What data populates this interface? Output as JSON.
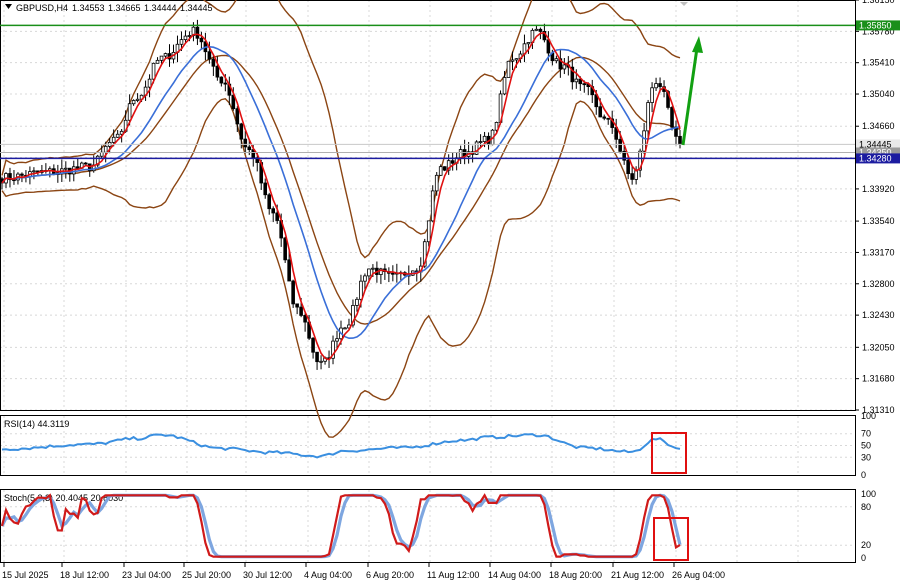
{
  "colors": {
    "background": "#ffffff",
    "grid": "#d8d8d8",
    "candle": "#000000",
    "bollinger": "#8b4513",
    "ma_fast": "#e01010",
    "ma_slow": "#3a6fd8",
    "resistance": "#1a8f1a",
    "support": "#1c1ca0",
    "arrow": "#12a012",
    "rsi": "#3a8fe0",
    "stoch_main": "#d01a1a",
    "stoch_signal": "#7ea6e0",
    "highlight_box": "#e01010"
  },
  "header": {
    "symbol": "GBPUSD,H4",
    "open": "1.34553",
    "high": "1.34665",
    "low": "1.34444",
    "close": "1.34445"
  },
  "price_scale": {
    "ticks": [
      "1.36150",
      "1.35780",
      "1.35410",
      "1.35040",
      "1.34660",
      "1.34290",
      "1.33920",
      "1.33540",
      "1.33170",
      "1.32800",
      "1.32430",
      "1.32050",
      "1.31680",
      "1.31310"
    ],
    "tags": [
      {
        "text": "1.35850",
        "bg": "#1a8f1a",
        "fg": "#ffffff",
        "price": 1.3585
      },
      {
        "text": "1.34445",
        "bg": "#e8e8e8",
        "fg": "#000000",
        "price": 1.34445
      },
      {
        "text": "1.34350",
        "bg": "#9a9a9a",
        "fg": "#ffffff",
        "price": 1.3435
      },
      {
        "text": "1.34280",
        "bg": "#1c1ca0",
        "fg": "#ffffff",
        "price": 1.3428
      }
    ]
  },
  "levels": {
    "resistance": 1.3585,
    "support": 1.3428,
    "current": 1.34445,
    "mid": 1.3435
  },
  "rsi_panel": {
    "label": "RSI(14) 44.3119",
    "ticks": [
      "100",
      "70",
      "50",
      "30",
      "0"
    ]
  },
  "stoch_panel": {
    "label": "Stoch(5,3,3) 20.4045 20.8030",
    "ticks": [
      "100",
      "80",
      "20",
      "0"
    ]
  },
  "time_axis": [
    "15 Jul 2025",
    "18 Jul 12:00",
    "23 Jul 04:00",
    "25 Jul 20:00",
    "30 Jul 12:00",
    "4 Aug 04:00",
    "6 Aug 20:00",
    "11 Aug 12:00",
    "14 Aug 04:00",
    "18 Aug 20:00",
    "21 Aug 12:00",
    "26 Aug 04:00"
  ],
  "chart_data": {
    "type": "line",
    "title": "GBPUSD,H4",
    "xlabel": "",
    "ylabel": "",
    "ylim": [
      1.3131,
      1.3615
    ],
    "anchors": {
      "x": [
        0,
        12,
        22,
        28,
        34,
        40,
        48,
        55,
        62,
        68,
        74,
        80,
        86,
        92,
        98,
        104,
        110,
        116,
        122,
        128,
        134,
        140,
        146,
        152,
        158,
        164,
        170
      ],
      "close": [
        1.3405,
        1.3412,
        1.3418,
        1.3448,
        1.3502,
        1.3546,
        1.3578,
        1.3521,
        1.3437,
        1.3362,
        1.325,
        1.3185,
        1.3232,
        1.3298,
        1.3287,
        1.3299,
        1.3416,
        1.3435,
        1.345,
        1.3547,
        1.3578,
        1.3538,
        1.351,
        1.347,
        1.3405,
        1.352,
        1.34445
      ]
    },
    "rsi": {
      "x": [
        0,
        22,
        34,
        40,
        55,
        68,
        80,
        86,
        100,
        116,
        122,
        134,
        146,
        158,
        164,
        170
      ],
      "values": [
        44,
        52,
        62,
        68,
        45,
        38,
        32,
        41,
        46,
        59,
        64,
        68,
        46,
        39,
        61,
        44.3119
      ]
    },
    "stoch": {
      "main_last": 20.4045,
      "signal_last": 20.803
    }
  }
}
